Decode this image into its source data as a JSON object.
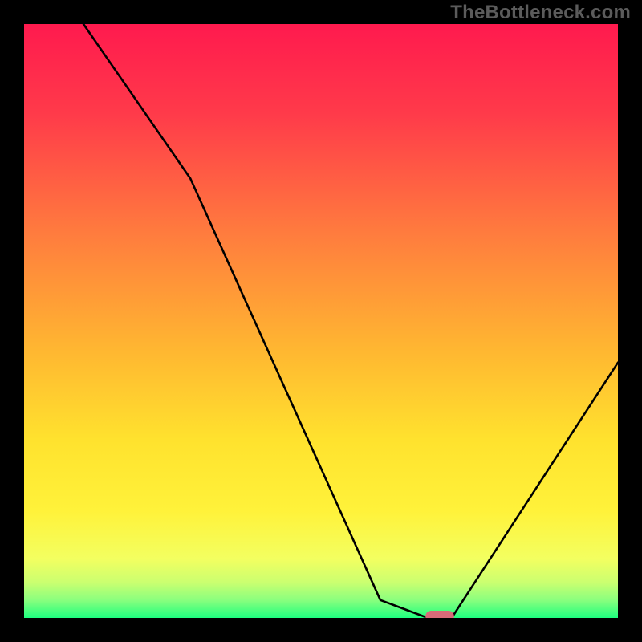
{
  "watermark": "TheBottleneck.com",
  "chart_data": {
    "type": "line",
    "title": "",
    "xlabel": "",
    "ylabel": "",
    "xlim": [
      0,
      100
    ],
    "ylim": [
      0,
      100
    ],
    "series": [
      {
        "name": "bottleneck-curve",
        "x": [
          10,
          28,
          60,
          68,
          72,
          100
        ],
        "values": [
          100,
          74,
          3,
          0,
          0,
          43
        ]
      }
    ],
    "marker": {
      "name": "optimum-pill",
      "x_start": 68,
      "x_end": 72,
      "y": 0,
      "color": "#d86a78"
    },
    "gradient_stops": [
      {
        "offset": 0.0,
        "color": "#ff1a4e"
      },
      {
        "offset": 0.15,
        "color": "#ff3a4a"
      },
      {
        "offset": 0.35,
        "color": "#ff7b3e"
      },
      {
        "offset": 0.55,
        "color": "#ffb731"
      },
      {
        "offset": 0.7,
        "color": "#ffe22e"
      },
      {
        "offset": 0.82,
        "color": "#fff23a"
      },
      {
        "offset": 0.9,
        "color": "#f3ff60"
      },
      {
        "offset": 0.94,
        "color": "#cbff70"
      },
      {
        "offset": 0.97,
        "color": "#8aff7e"
      },
      {
        "offset": 1.0,
        "color": "#1eff7f"
      }
    ]
  }
}
